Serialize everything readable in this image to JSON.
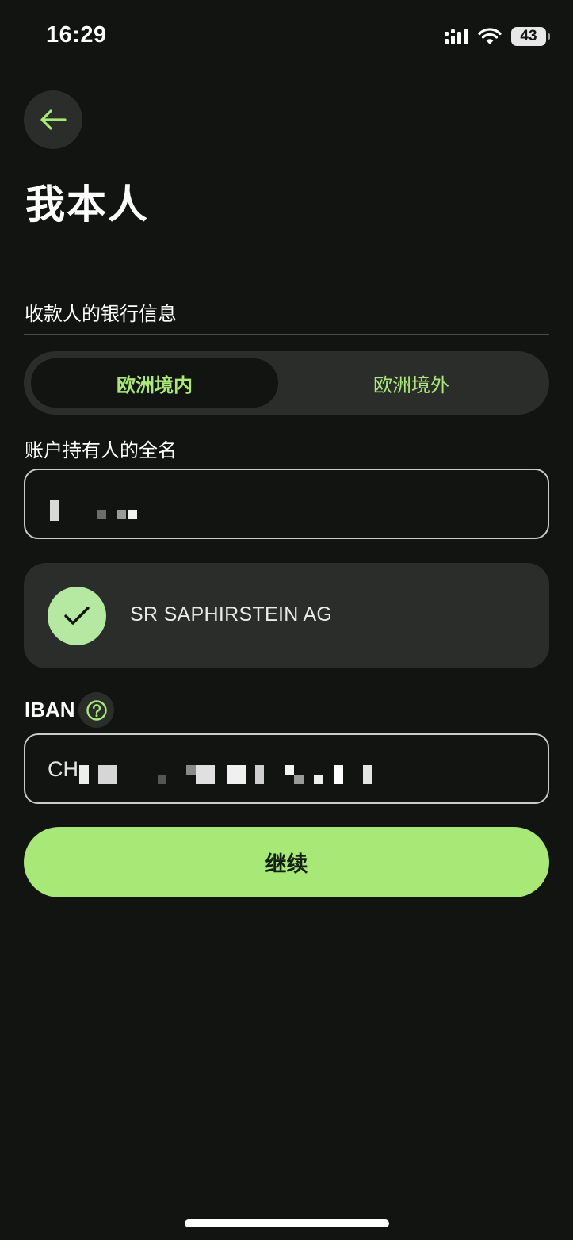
{
  "status_bar": {
    "time": "16:29",
    "battery": "43",
    "icons": [
      "cellular-signal-icon",
      "wifi-icon",
      "battery-icon"
    ]
  },
  "header": {
    "back_icon": "arrow-left-icon",
    "title": "我本人"
  },
  "bank_info": {
    "section_label": "收款人的银行信息",
    "tabs": [
      {
        "label": "欧洲境内",
        "selected": true
      },
      {
        "label": "欧洲境外",
        "selected": false
      }
    ]
  },
  "holder": {
    "label": "账户持有人的全名"
  },
  "verification": {
    "icon": "checkmark-icon",
    "matched_name": "SR SAPHIRSTEIN AG"
  },
  "iban": {
    "label": "IBAN",
    "help_icon": "question-circle-icon",
    "visible_prefix": "CH"
  },
  "actions": {
    "continue_label": "继续"
  },
  "colors": {
    "background": "#121412",
    "surface": "#2b2d2b",
    "accent": "#a7e877",
    "accent_text": "#a9e879"
  }
}
